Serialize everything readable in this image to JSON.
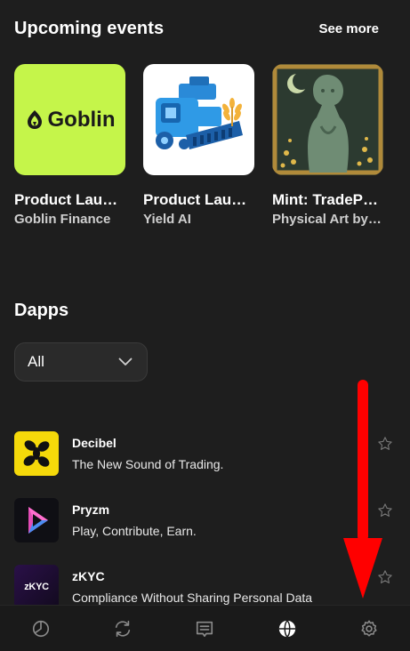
{
  "events_section": {
    "title": "Upcoming events",
    "see_more": "See more"
  },
  "events": [
    {
      "title": "Product Lau…",
      "subtitle": "Goblin Finance",
      "logo_text": "Goblin"
    },
    {
      "title": "Product Lau…",
      "subtitle": "Yield AI"
    },
    {
      "title": "Mint: TradeP…",
      "subtitle": "Physical Art by …"
    }
  ],
  "dapps_section": {
    "title": "Dapps",
    "filter_value": "All"
  },
  "dapps": [
    {
      "name": "Decibel",
      "description": "The New Sound of Trading."
    },
    {
      "name": "Pryzm",
      "description": "Play, Contribute, Earn."
    },
    {
      "name": "zKYC",
      "description": "Compliance Without Sharing Personal Data",
      "icon_text": "zKYC"
    }
  ],
  "bottom_nav": [
    {
      "icon": "portfolio-pie-icon"
    },
    {
      "icon": "swap-refresh-icon"
    },
    {
      "icon": "activity-receipt-icon"
    },
    {
      "icon": "globe-icon",
      "active": true
    },
    {
      "icon": "gear-icon"
    }
  ],
  "colors": {
    "background": "#1e1e1e",
    "goblin_bg": "#c5f54a",
    "decibel_bg": "#f5d90a",
    "annotation_arrow": "#ff0000"
  }
}
